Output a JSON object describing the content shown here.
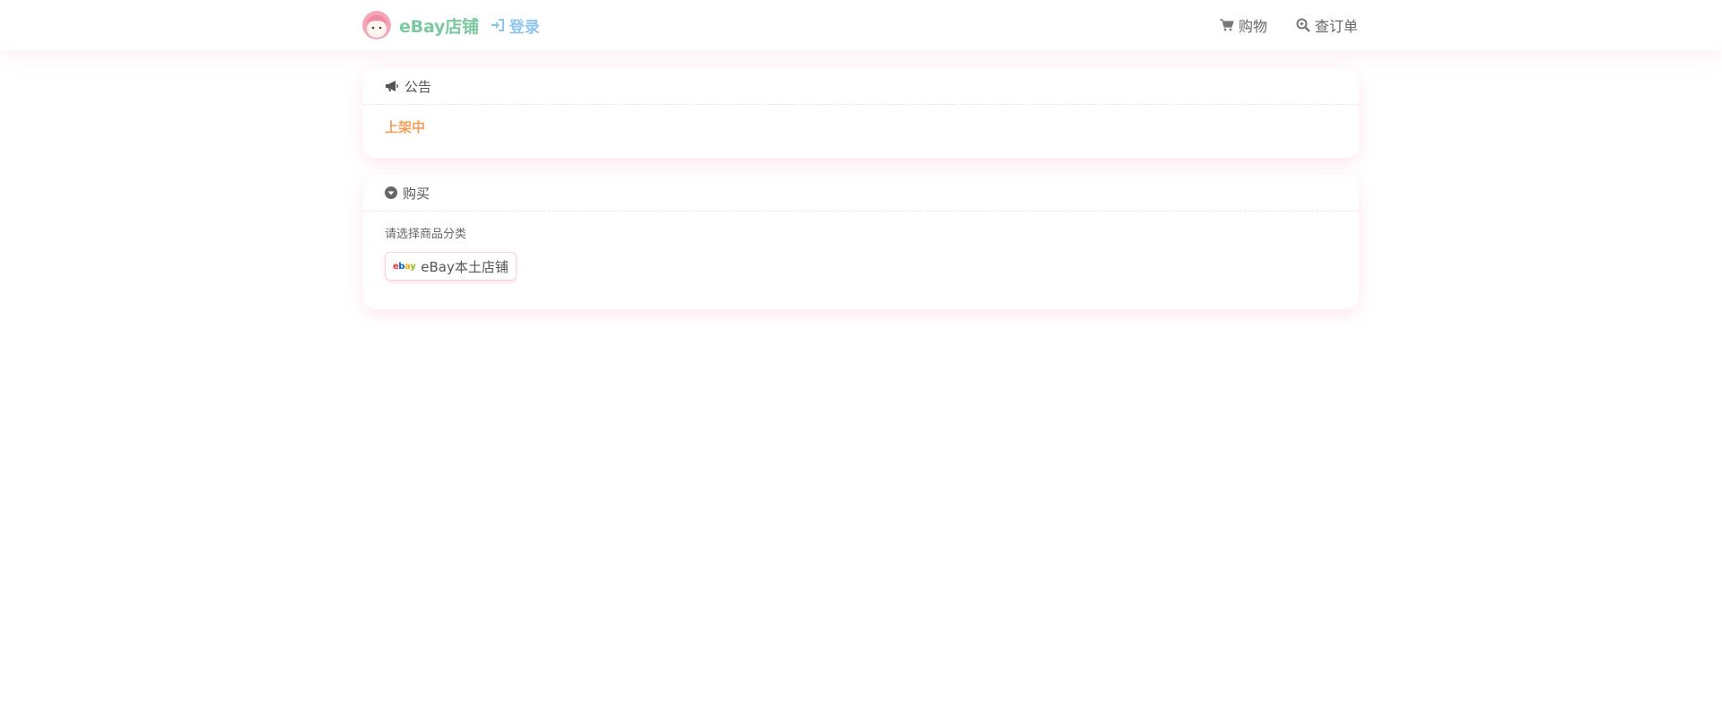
{
  "header": {
    "brand_name": "eBay店铺",
    "login_label": "登录",
    "nav": [
      {
        "label": "购物",
        "icon": "cart-icon"
      },
      {
        "label": "查订单",
        "icon": "search-icon"
      }
    ]
  },
  "announcement": {
    "title": "公告",
    "icon": "megaphone-icon",
    "text": "上架中",
    "text_color": "#f5a05a"
  },
  "purchase": {
    "title": "购买",
    "icon": "chevron-down-circle-icon",
    "select_label": "请选择商品分类",
    "categories": [
      {
        "label": "eBay本土店铺",
        "icon": "ebay-logo-icon"
      }
    ]
  },
  "colors": {
    "brand": "#7cc8a0",
    "login": "#8fc6f0",
    "accent_shadow": "#ffb6d2"
  }
}
